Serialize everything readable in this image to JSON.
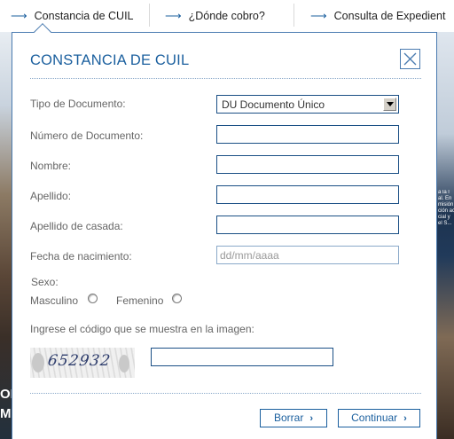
{
  "nav": {
    "items": [
      {
        "label": "Constancia de CUIL"
      },
      {
        "label": "¿Dónde cobro?"
      },
      {
        "label": "Consulta de Expedient"
      }
    ],
    "arrow": "⟶"
  },
  "background": {
    "left_text": "OI\nMA",
    "right_text": "a la l\nal. En\nmisión\nción ac\ncial y\nel S..."
  },
  "modal": {
    "title": "CONSTANCIA DE CUIL",
    "close_icon": "close-icon",
    "fields": {
      "tipo_documento": {
        "label": "Tipo de Documento:",
        "value": "DU Documento Único"
      },
      "numero_documento": {
        "label": "Número de Documento:",
        "value": ""
      },
      "nombre": {
        "label": "Nombre:",
        "value": ""
      },
      "apellido": {
        "label": "Apellido:",
        "value": ""
      },
      "apellido_casada": {
        "label": "Apellido de casada:",
        "value": ""
      },
      "fecha_nacimiento": {
        "label": "Fecha de nacimiento:",
        "value": "",
        "placeholder": "dd/mm/aaaa"
      }
    },
    "sexo": {
      "label": "Sexo:",
      "options": [
        {
          "label": "Masculino"
        },
        {
          "label": "Femenino"
        }
      ]
    },
    "captcha": {
      "label": "Ingrese el código que se muestra en la imagen:",
      "code": "652932",
      "value": ""
    },
    "buttons": {
      "borrar": "Borrar",
      "continuar": "Continuar",
      "chevron": "›"
    }
  },
  "colors": {
    "accent": "#1a5f9e",
    "border": "#4a7bb0",
    "label_text": "#666666"
  }
}
